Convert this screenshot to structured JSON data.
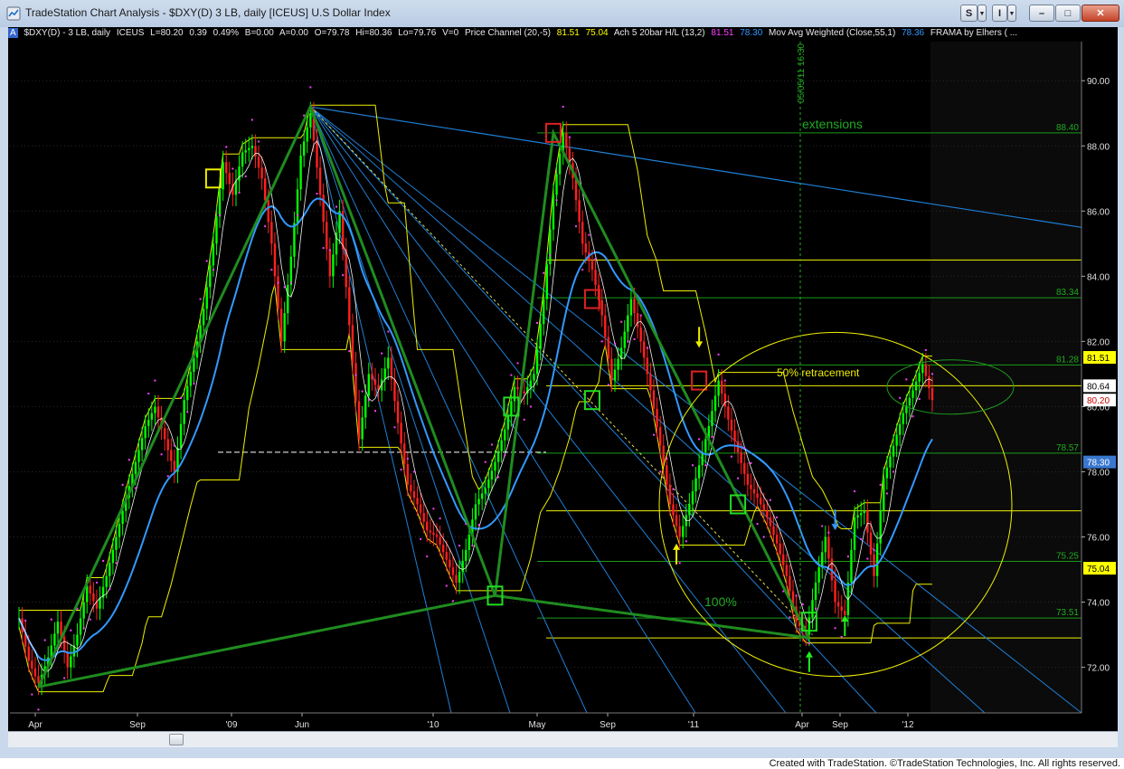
{
  "window": {
    "title": "TradeStation Chart Analysis - $DXY(D) 3 LB, daily [ICEUS] U.S Dollar Index",
    "buttons": {
      "s_menu": "S",
      "i_menu": "I",
      "minimize": "–",
      "maximize": "□",
      "close": "✕"
    }
  },
  "status": {
    "badge": "A",
    "symbol": "$DXY(D) - 3 LB, daily",
    "exchange": "ICEUS",
    "last": "L=80.20",
    "change": "0.39",
    "change_pct": "0.49%",
    "bid": "B=0.00",
    "ask": "A=0.00",
    "open": "O=79.78",
    "high": "Hi=80.36",
    "low": "Lo=79.76",
    "volume": "V=0",
    "price_channel": {
      "label": "Price Channel (20,-5)",
      "v1": "81.51",
      "v2": "75.04"
    },
    "ach": {
      "label": "Ach 5 20bar H/L (13,2)",
      "v1": "81.51",
      "v2": "78.30"
    },
    "mavg": {
      "label": "Mov Avg Weighted (Close,55,1)",
      "v1": "78.36"
    },
    "frama": {
      "label": "FRAMA by Elhers ( ..."
    }
  },
  "colors": {
    "background": "#000000",
    "candle_up": "#00ff00",
    "candle_down": "#ff2020",
    "channel": "#f0f000",
    "mavg": "#3399ff",
    "trend": "#1f8c1f",
    "fan": "#1e7fd6",
    "frama": "#ff40ff",
    "fib": "#1a9a1a"
  },
  "chart_data": {
    "type": "line",
    "title": "",
    "xlabel": "",
    "ylabel": "",
    "ylim": [
      70.6,
      91.2
    ],
    "y_ticks": [
      "90.00",
      "88.00",
      "86.00",
      "84.00",
      "82.00",
      "80.00",
      "78.00",
      "76.00",
      "74.00",
      "72.00"
    ],
    "x_ticks": [
      "Apr",
      "Sep",
      "'09",
      "Jun",
      "'10",
      "May",
      "Sep",
      "'11",
      "Apr",
      "Sep",
      "'12"
    ],
    "cursor_label": "05/05/11 16:30",
    "annotations": {
      "extensions": "extensions",
      "retracement": "50% retracement",
      "hundred": "100%"
    },
    "fib_levels": [
      {
        "label": "88.40",
        "value": 88.4
      },
      {
        "label": "83.34",
        "value": 83.34
      },
      {
        "label": "81.28",
        "value": 81.28
      },
      {
        "label": "78.57",
        "value": 78.57
      },
      {
        "label": "75.25",
        "value": 75.25
      },
      {
        "label": "73.51",
        "value": 73.51
      }
    ],
    "price_tags": [
      {
        "label": "81.51",
        "value": 81.51,
        "bg": "#ffff00",
        "fg": "#000000"
      },
      {
        "label": "80.64",
        "value": 80.64,
        "bg": "#ffffff",
        "fg": "#000000"
      },
      {
        "label": "80.20",
        "value": 80.2,
        "bg": "#ffffff",
        "fg": "#cc0000"
      },
      {
        "label": "78.30",
        "value": 78.3,
        "bg": "#3a78d0",
        "fg": "#ffffff"
      },
      {
        "label": "75.04",
        "value": 75.04,
        "bg": "#ffff00",
        "fg": "#000000"
      }
    ],
    "series": [
      {
        "name": "",
        "values": [
          [
            0,
            73.5
          ],
          [
            3,
            72.2
          ],
          [
            6,
            71.5
          ],
          [
            9,
            72.3
          ],
          [
            12,
            73.4
          ],
          [
            15,
            72.0
          ],
          [
            18,
            73.0
          ],
          [
            21,
            74.5
          ],
          [
            24,
            73.8
          ],
          [
            27,
            74.8
          ],
          [
            30,
            76.0
          ],
          [
            33,
            77.2
          ],
          [
            36,
            78.3
          ],
          [
            39,
            79.4
          ],
          [
            42,
            80.0
          ],
          [
            45,
            79.0
          ],
          [
            48,
            78.0
          ],
          [
            51,
            80.2
          ],
          [
            54,
            81.5
          ],
          [
            57,
            83.0
          ],
          [
            60,
            85.0
          ],
          [
            63,
            87.5
          ],
          [
            66,
            86.5
          ],
          [
            69,
            87.8
          ],
          [
            72,
            88.0
          ],
          [
            75,
            87.0
          ],
          [
            78,
            85.0
          ],
          [
            81,
            82.0
          ],
          [
            84,
            84.6
          ],
          [
            87,
            87.7
          ],
          [
            90,
            89.0
          ],
          [
            93,
            86.5
          ],
          [
            96,
            84.0
          ],
          [
            99,
            86.0
          ],
          [
            102,
            82.5
          ],
          [
            105,
            79.0
          ],
          [
            108,
            81.0
          ],
          [
            111,
            80.5
          ],
          [
            114,
            81.5
          ],
          [
            117,
            79.5
          ],
          [
            120,
            77.6
          ],
          [
            123,
            77.0
          ],
          [
            126,
            76.2
          ],
          [
            129,
            76.0
          ],
          [
            132,
            75.3
          ],
          [
            135,
            74.6
          ],
          [
            138,
            75.6
          ],
          [
            141,
            77.0
          ],
          [
            144,
            77.5
          ],
          [
            147,
            78.3
          ],
          [
            150,
            79.3
          ],
          [
            153,
            80.6
          ],
          [
            156,
            80.4
          ],
          [
            159,
            81.0
          ],
          [
            162,
            83.3
          ],
          [
            165,
            86.5
          ],
          [
            168,
            88.4
          ],
          [
            171,
            87.0
          ],
          [
            174,
            85.0
          ],
          [
            177,
            84.2
          ],
          [
            180,
            82.8
          ],
          [
            183,
            80.8
          ],
          [
            186,
            81.8
          ],
          [
            189,
            83.3
          ],
          [
            192,
            82.0
          ],
          [
            195,
            80.5
          ],
          [
            198,
            78.8
          ],
          [
            201,
            77.0
          ],
          [
            204,
            76.0
          ],
          [
            207,
            77.0
          ],
          [
            210,
            78.2
          ],
          [
            213,
            79.4
          ],
          [
            216,
            80.8
          ],
          [
            219,
            79.6
          ],
          [
            222,
            78.6
          ],
          [
            225,
            77.6
          ],
          [
            228,
            77.2
          ],
          [
            231,
            76.6
          ],
          [
            234,
            75.8
          ],
          [
            237,
            74.8
          ],
          [
            240,
            73.4
          ],
          [
            243,
            73.0
          ],
          [
            246,
            74.6
          ],
          [
            249,
            76.0
          ],
          [
            252,
            74.0
          ],
          [
            255,
            73.6
          ],
          [
            258,
            76.6
          ],
          [
            261,
            76.8
          ],
          [
            264,
            74.8
          ],
          [
            267,
            77.8
          ],
          [
            270,
            78.8
          ],
          [
            273,
            79.8
          ],
          [
            276,
            80.5
          ],
          [
            279,
            81.3
          ],
          [
            282,
            80.2
          ]
        ]
      }
    ]
  },
  "credit": "Created with TradeStation. ©TradeStation Technologies, Inc. All rights reserved."
}
